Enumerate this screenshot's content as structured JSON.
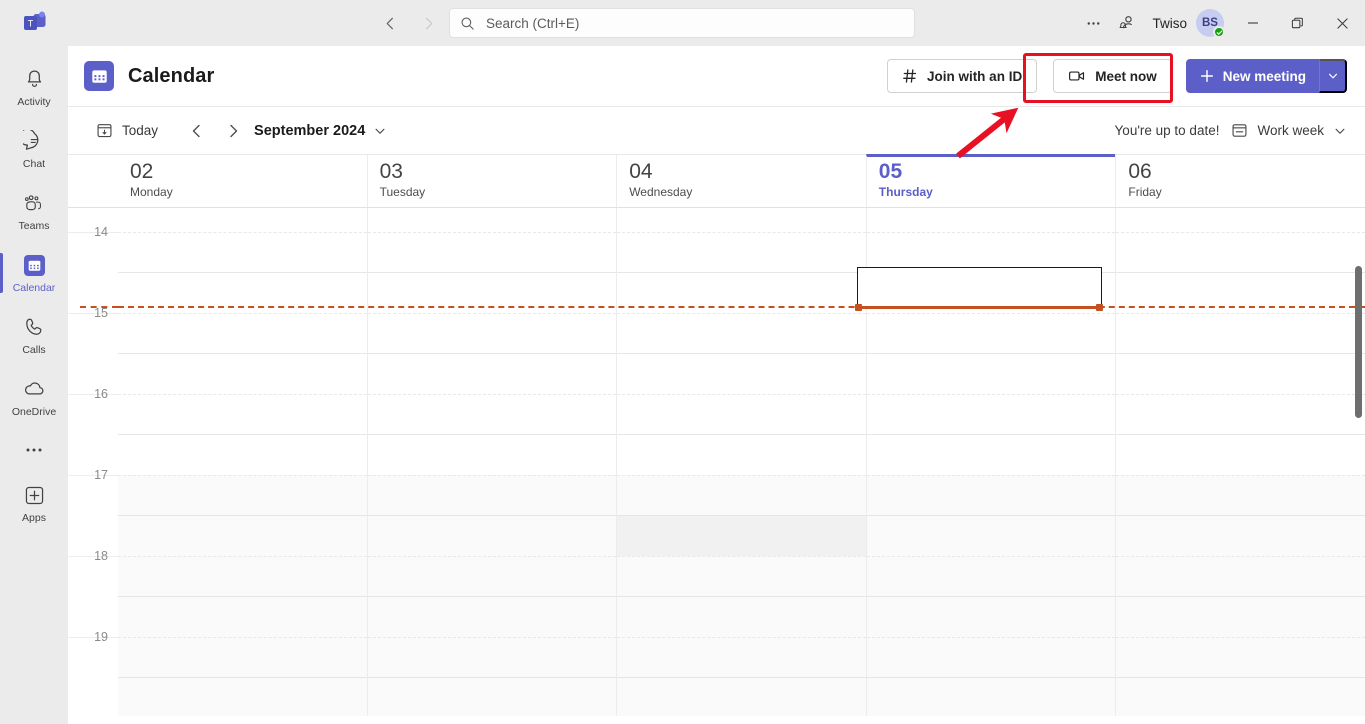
{
  "titlebar": {
    "app_logo": "teams-logo",
    "back_label": "back",
    "forward_label": "forward",
    "more_label": "...",
    "user_name": "Twiso",
    "avatar_initials": "BS",
    "presence": "available",
    "minimize": "minimize",
    "maximize": "restore",
    "close": "close"
  },
  "search": {
    "placeholder": "Search (Ctrl+E)",
    "value": "Search (Ctrl+E)"
  },
  "rail": {
    "items": [
      {
        "label": "Activity",
        "icon": "bell-icon",
        "active": false
      },
      {
        "label": "Chat",
        "icon": "chat-icon",
        "active": false
      },
      {
        "label": "Teams",
        "icon": "teams-icon",
        "active": false
      },
      {
        "label": "Calendar",
        "icon": "calendar-icon",
        "active": true
      },
      {
        "label": "Calls",
        "icon": "phone-icon",
        "active": false
      },
      {
        "label": "OneDrive",
        "icon": "cloud-icon",
        "active": false
      }
    ],
    "more": "...",
    "apps": {
      "label": "Apps",
      "icon": "plus-box-icon"
    }
  },
  "header": {
    "title": "Calendar",
    "join_with_id": "Join with an ID",
    "meet_now": "Meet now",
    "new_meeting": "New meeting",
    "new_meeting_caret": "chevron-down",
    "accent_color": "#5b5fc7",
    "annotation_color": "#e81123"
  },
  "toolbar": {
    "today": "Today",
    "prev": "previous",
    "next": "next",
    "month": "September 2024",
    "month_caret": "chevron-down",
    "status": "You're up to date!",
    "view": "Work week",
    "view_caret": "chevron-down"
  },
  "calendar": {
    "days": [
      {
        "num": "02",
        "name": "Monday",
        "today": false
      },
      {
        "num": "03",
        "name": "Tuesday",
        "today": false
      },
      {
        "num": "04",
        "name": "Wednesday",
        "today": false
      },
      {
        "num": "05",
        "name": "Thursday",
        "today": true
      },
      {
        "num": "06",
        "name": "Friday",
        "today": false
      }
    ],
    "hours": [
      "14",
      "15",
      "16",
      "17",
      "18",
      "19"
    ],
    "now_indicator_color": "#c4511f",
    "selection": {
      "day": "05",
      "start": "14:30",
      "end": "15:00"
    }
  }
}
